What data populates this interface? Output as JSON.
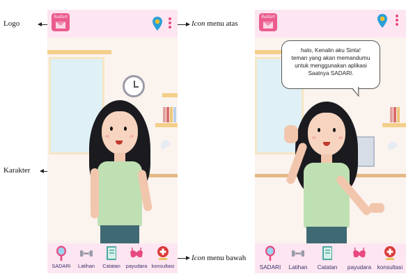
{
  "annotations": {
    "logo": "Logo",
    "top_menu_icon_word": "Icon",
    "top_menu_rest": " menu atas",
    "character": "Karakter",
    "bottom_menu_icon_word": "Icon",
    "bottom_menu_rest": " menu bawah"
  },
  "app": {
    "logo_text": "Sadari"
  },
  "bubble": {
    "lines": [
      "halo, Kenalin aku Sinta!",
      "teman yang akan memandumu",
      "untuk menggunakan aplikasi",
      "Saatnya SADARI."
    ]
  },
  "bottom_nav": {
    "items": [
      {
        "label": "SADARI",
        "icon": "mirror-icon"
      },
      {
        "label": "Latihan",
        "icon": "dumbbell-icon"
      },
      {
        "label": "Catatan",
        "icon": "notebook-icon"
      },
      {
        "label": "payudara",
        "icon": "bra-icon"
      },
      {
        "label": "konsultasi",
        "icon": "first-aid-icon"
      }
    ]
  },
  "colors": {
    "bar_background": "#fde6f1",
    "accent_pink": "#e84a7f",
    "pin_blue": "#2a9fd8",
    "label_text": "#3b2f6b"
  }
}
